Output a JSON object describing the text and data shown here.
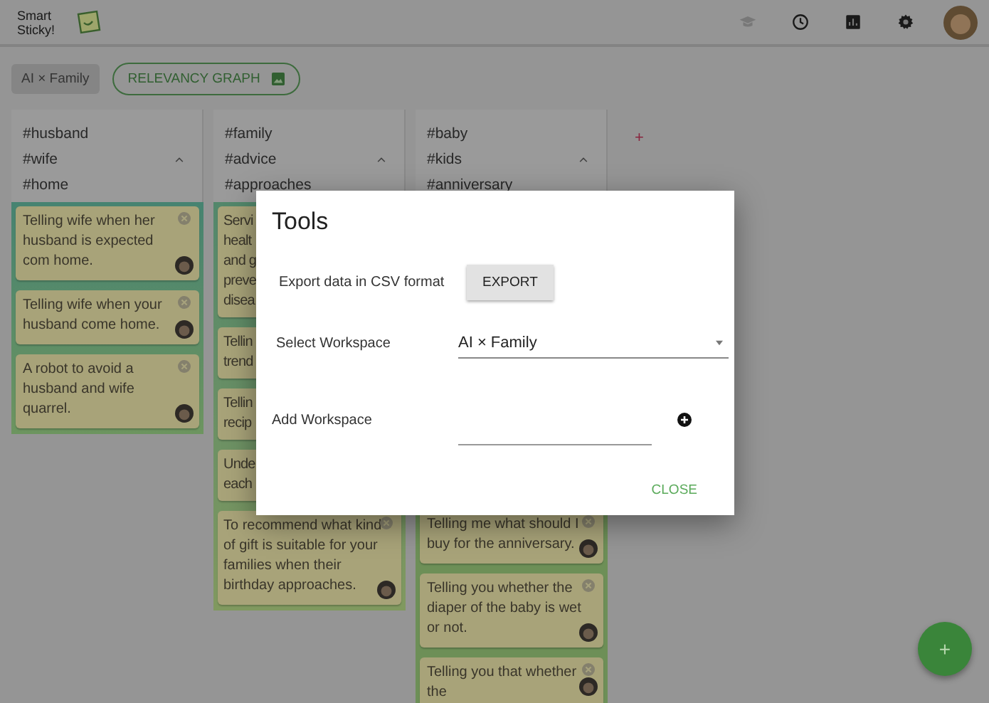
{
  "app_bar": {
    "logo_text": "Smart Sticky!"
  },
  "toolbar": {
    "workspace_chip": "AI × Family",
    "graph_button": "RELEVANCY GRAPH"
  },
  "columns": [
    {
      "tags": [
        "#husband",
        "#wife",
        "#home"
      ],
      "expanded": true,
      "cards": [
        {
          "kind": "full",
          "text": "Telling wife when her husband is expected com home."
        },
        {
          "kind": "full",
          "text": "Telling wife when your husband come home."
        },
        {
          "kind": "full",
          "text": "A robot to avoid a husband and wife quarrel."
        }
      ]
    },
    {
      "tags": [
        "#family",
        "#advice",
        "#approaches"
      ],
      "expanded": true,
      "cards": [
        {
          "kind": "cropped",
          "lines": [
            "Servi",
            "healt",
            "and g",
            "preve",
            "disea"
          ]
        },
        {
          "kind": "cropped",
          "lines": [
            "Tellin",
            "trend"
          ]
        },
        {
          "kind": "cropped",
          "lines": [
            "Tellin",
            "recip"
          ]
        },
        {
          "kind": "cropped",
          "lines": [
            "Unde",
            "each"
          ]
        },
        {
          "kind": "full",
          "text": "To recommend what kind of gift is suitable for your families when their birthday approaches."
        }
      ]
    },
    {
      "tags": [
        "#baby",
        "#kids",
        "#anniversary"
      ],
      "expanded": true,
      "cards": [
        {
          "kind": "full",
          "text": "Telling me what should I buy for the anniversary."
        },
        {
          "kind": "full",
          "text": "Telling you whether the diaper of the baby is wet or not."
        },
        {
          "kind": "full",
          "text": "Telling you that whether the"
        }
      ]
    }
  ],
  "add_column": "+",
  "dialog": {
    "title": "Tools",
    "export_label": "Export data in CSV format",
    "export_button": "EXPORT",
    "select_label": "Select Workspace",
    "select_value": "AI × Family",
    "add_label": "Add Workspace",
    "close_button": "CLOSE"
  },
  "fab": "+"
}
